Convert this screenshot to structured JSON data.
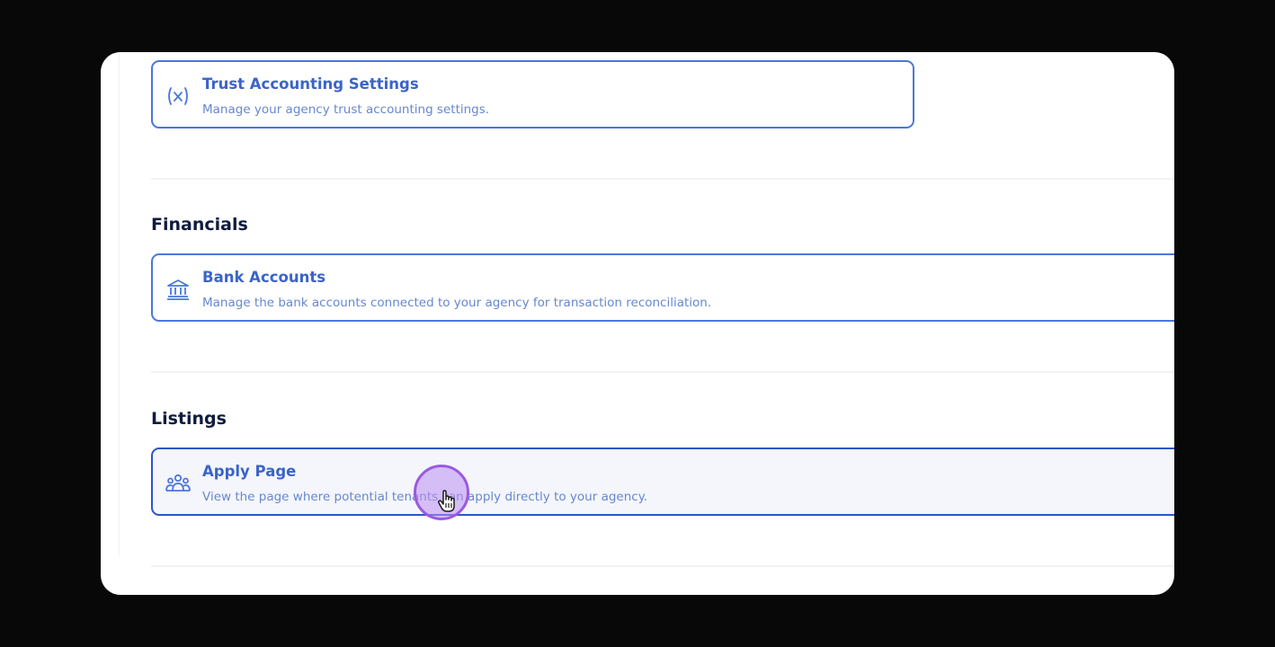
{
  "cards": {
    "trust": {
      "title": "Trust Accounting Settings",
      "description": "Manage your agency trust accounting settings.",
      "icon": "variable-icon"
    },
    "bank": {
      "title": "Bank Accounts",
      "description": "Manage the bank accounts connected to your agency for transaction reconciliation.",
      "icon": "bank-icon"
    },
    "apply": {
      "title": "Apply Page",
      "description": "View the page where potential tenants can apply directly to your agency.",
      "icon": "users-group-icon"
    }
  },
  "sections": {
    "financials": "Financials",
    "listings": "Listings"
  },
  "colors": {
    "accent": "#4a77dc",
    "heading": "#0f1c3d",
    "cursor": "#9b59e0"
  }
}
